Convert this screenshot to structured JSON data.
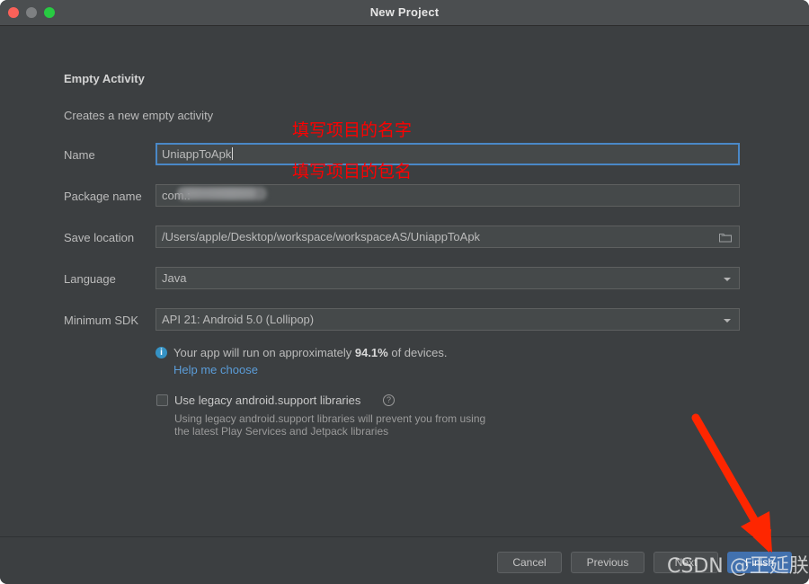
{
  "window": {
    "title": "New Project",
    "traffic_lights": [
      "close-button",
      "minimize-button",
      "maximize-button"
    ]
  },
  "content": {
    "heading": "Empty Activity",
    "subheading": "Creates a new empty activity"
  },
  "form": {
    "rows": [
      {
        "label": "Name",
        "value": "UniappToApk"
      },
      {
        "label": "Package name",
        "value": "com.:"
      },
      {
        "label": "Save location",
        "value": "/Users/apple/Desktop/workspace/workspaceAS/UniappToApk"
      },
      {
        "label": "Language",
        "value": "Java"
      },
      {
        "label": "Minimum SDK",
        "value": "API 21: Android 5.0 (Lollipop)"
      }
    ]
  },
  "info": {
    "icon": "info-icon",
    "text_before": "Your app will run on approximately ",
    "percent": "94.1%",
    "text_after": " of devices.",
    "help_link": "Help me choose"
  },
  "legacy": {
    "checkbox_label": "Use legacy android.support libraries",
    "help_glyph": "?",
    "description_line1": "Using legacy android.support libraries will prevent you from using",
    "description_line2": "the latest Play Services and Jetpack libraries"
  },
  "footer": {
    "cancel": "Cancel",
    "previous": "Previous",
    "next": "Next",
    "finish": "Finish"
  },
  "annotations": {
    "name_note": "填写项目的名字",
    "package_note": "填写项目的包名",
    "arrow": "red-arrow-pointing-to-finish",
    "watermark": "CSDN @王延朕"
  },
  "colors": {
    "window_bg": "#3c3f41",
    "titlebar_bg": "#4b4e50",
    "field_bg": "#45494a",
    "accent_blue": "#4271ae",
    "focus_blue": "#4a88c7",
    "link_blue": "#5b9dd9",
    "info_blue": "#3592c4",
    "annotation_red": "#fe0000"
  }
}
